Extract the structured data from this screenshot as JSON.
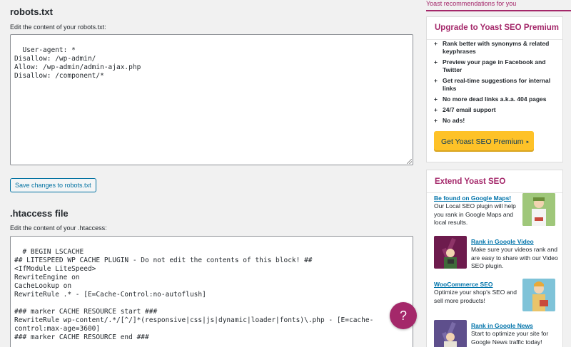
{
  "robots": {
    "title": "robots.txt",
    "label": "Edit the content of your robots.txt:",
    "content": "User-agent: *\nDisallow: /wp-admin/\nAllow: /wp-admin/admin-ajax.php\nDisallow: /component/*",
    "save_label": "Save changes to robots.txt"
  },
  "htaccess": {
    "title": ".htaccess file",
    "label": "Edit the content of your .htaccess:",
    "content": "# BEGIN LSCACHE\n## LITESPEED WP CACHE PLUGIN - Do not edit the contents of this block! ##\n<IfModule LiteSpeed>\nRewriteEngine on\nCacheLookup on\nRewriteRule .* - [E=Cache-Control:no-autoflush]\n\n### marker CACHE RESOURCE start ###\nRewriteRule wp-content/.*/[^/]*(responsive|css|js|dynamic|loader|fonts)\\.php - [E=cache-control:max-age=3600]\n### marker CACHE RESOURCE end ###\n\n### marker LOGIN COOKIE start ###"
  },
  "help": {
    "label": "?"
  },
  "sidebar": {
    "header": "Yoast recommendations for you",
    "premium": {
      "title": "Upgrade to Yoast SEO Premium",
      "benefits": [
        "Rank better with synonyms & related keyphrases",
        "Preview your page in Facebook and Twitter",
        "Get real-time suggestions for internal links",
        "No more dead links a.k.a. 404 pages",
        "24/7 email support",
        "No ads!"
      ],
      "button_label": "Get Yoast SEO Premium",
      "button_arrow": "▸"
    },
    "extend": {
      "title": "Extend Yoast SEO",
      "items": [
        {
          "link": "Be found on Google Maps!",
          "desc": "Our Local SEO plugin will help you rank in Google Maps and local results.",
          "icon": "local-seo-icon"
        },
        {
          "link": "Rank in Google Video",
          "desc": "Make sure your videos rank and are easy to share with our Video SEO plugin.",
          "icon": "video-seo-icon"
        },
        {
          "link": "WooCommerce SEO",
          "desc": "Optimize your shop's SEO and sell more products!",
          "icon": "woocommerce-seo-icon"
        },
        {
          "link": "Rank in Google News",
          "desc": "Start to optimize your site for Google News traffic today!",
          "icon": "news-seo-icon"
        }
      ]
    }
  },
  "colors": {
    "accent": "#a4286a",
    "link": "#0073aa",
    "premium_button": "#fec228",
    "background": "#f1f1f1"
  }
}
